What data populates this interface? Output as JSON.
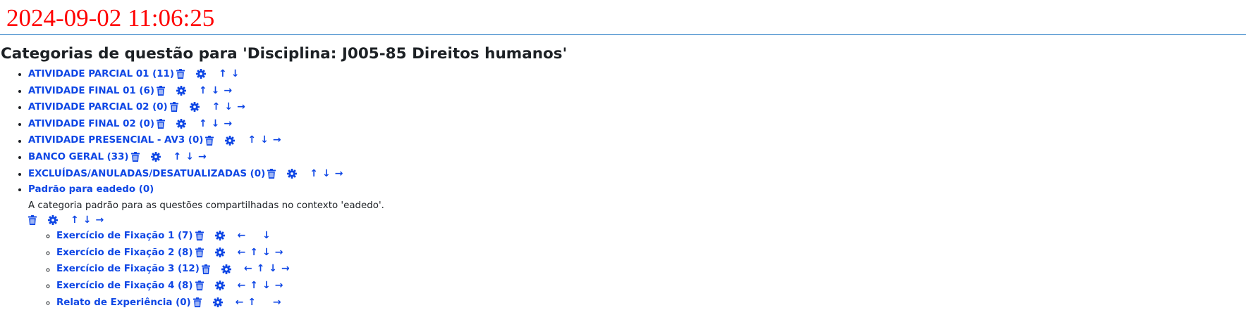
{
  "timestamp": "2024-09-02 11:06:25",
  "page_title": "Categorias de questão para 'Disciplina: J005-85 Direitos humanos'",
  "accent_color": "#0f47e5",
  "timestamp_color": "#ff0000",
  "categories": [
    {
      "label": "ATIVIDADE PARCIAL 01 (11)"
    },
    {
      "label": "ATIVIDADE FINAL 01 (6)"
    },
    {
      "label": "ATIVIDADE PARCIAL 02 (0)"
    },
    {
      "label": "ATIVIDADE FINAL 02 (0)"
    },
    {
      "label": "ATIVIDADE PRESENCIAL - AV3 (0)"
    },
    {
      "label": "BANCO GERAL (33)"
    },
    {
      "label": "EXCLUÍDAS/ANULADAS/DESATUALIZADAS (0)"
    },
    {
      "label": "Padrão para eadedo (0)",
      "description": "A categoria padrão para as questões compartilhadas no contexto 'eadedo'.",
      "children": [
        {
          "label": "Exercício de Fixação 1 (7)"
        },
        {
          "label": "Exercício de Fixação 2 (8)"
        },
        {
          "label": "Exercício de Fixação 3 (12)"
        },
        {
          "label": "Exercício de Fixação 4 (8)"
        },
        {
          "label": "Relato de Experiência (0)"
        }
      ]
    }
  ],
  "icons": {
    "delete": "trash-icon",
    "edit": "gear-icon",
    "move_up": "arrow-up-icon",
    "move_down": "arrow-down-icon",
    "move_left": "arrow-left-icon",
    "move_right": "arrow-right-icon",
    "up_glyph": "↑",
    "down_glyph": "↓",
    "left_glyph": "←",
    "right_glyph": "→"
  }
}
